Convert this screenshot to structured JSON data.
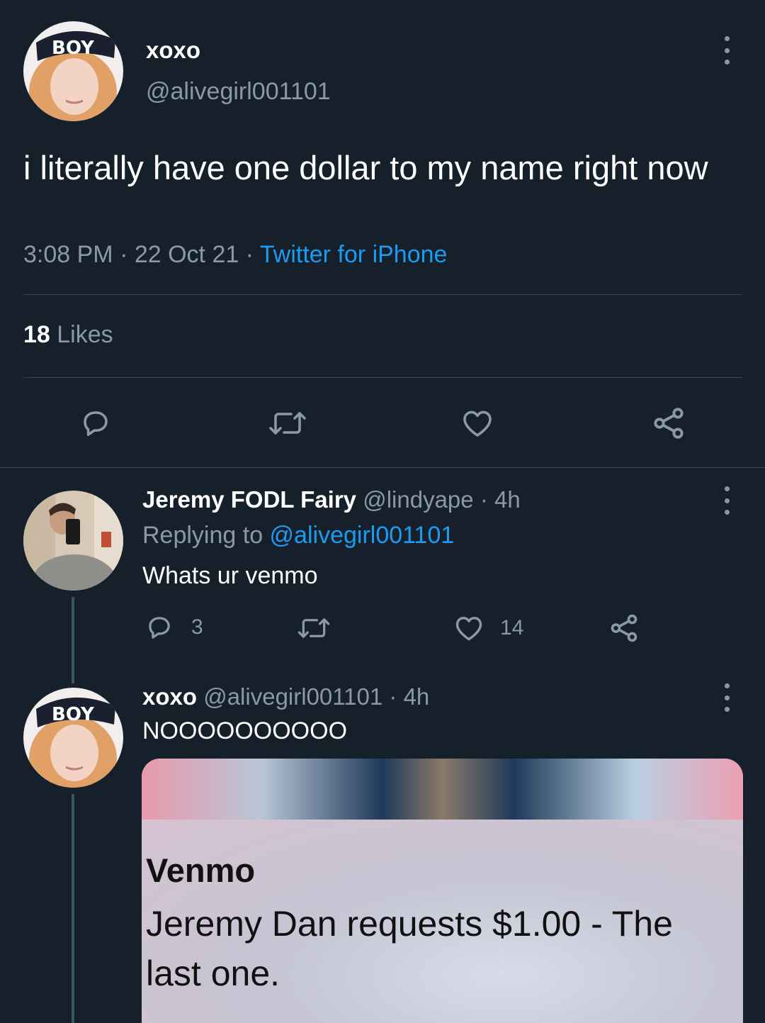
{
  "main_tweet": {
    "author_name": "xoxo",
    "author_handle": "@alivegirl001101",
    "text": "i literally have one dollar to my name right now",
    "time": "3:08 PM",
    "date": "22 Oct 21",
    "separator": " · ",
    "source": "Twitter for iPhone",
    "likes_count": "18",
    "likes_label": " Likes"
  },
  "replies": [
    {
      "author_name": "Jeremy FODL Fairy",
      "author_handle": "@lindyape",
      "age": "· 4h",
      "replying_label": "Replying to ",
      "replying_to": "@alivegirl001101",
      "text": "Whats ur venmo",
      "reply_count": "3",
      "like_count": "14"
    },
    {
      "author_name": "xoxo",
      "author_handle": "@alivegirl001101",
      "age": "· 4h",
      "text": "NOOOOOOOOOO",
      "media": {
        "notification_title": "Venmo",
        "notification_body": "Jeremy Dan requests $1.00 - The last one."
      }
    }
  ],
  "colors": {
    "background": "#15202b",
    "secondary_text": "#8b98a5",
    "accent": "#1d9bf0",
    "divider": "#38444d"
  },
  "icons": [
    "more-vertical-icon",
    "reply-icon",
    "retweet-icon",
    "like-icon",
    "share-icon"
  ]
}
